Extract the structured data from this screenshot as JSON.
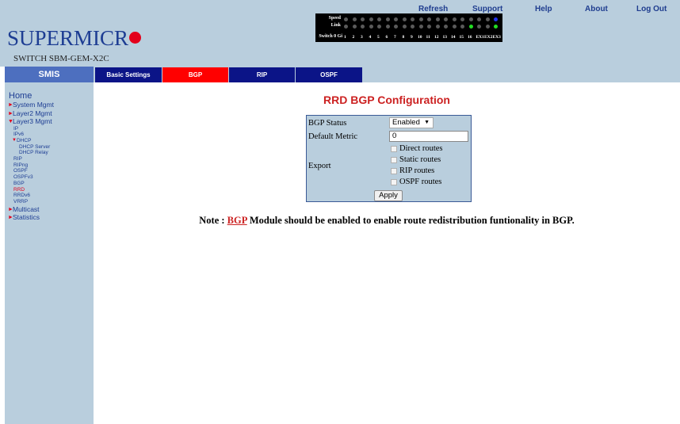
{
  "header": {
    "links": [
      "Refresh",
      "Support",
      "Help",
      "About",
      "Log Out"
    ],
    "logo_text": "SUPERMICR",
    "switch_name": "SWITCH SBM-GEM-X2C"
  },
  "port_panel": {
    "row_labels": [
      "Speed",
      "Link",
      "Switch 0 Gi"
    ],
    "port_numbers": [
      "1",
      "2",
      "3",
      "4",
      "5",
      "6",
      "7",
      "8",
      "9",
      "10",
      "11",
      "12",
      "13",
      "14",
      "15",
      "16",
      "EX1",
      "EX2",
      "EX3"
    ],
    "speed_leds": [
      "off",
      "off",
      "off",
      "off",
      "off",
      "off",
      "off",
      "off",
      "off",
      "off",
      "off",
      "off",
      "off",
      "off",
      "off",
      "off",
      "off",
      "off",
      "blue"
    ],
    "link_leds": [
      "off",
      "off",
      "off",
      "off",
      "off",
      "off",
      "off",
      "off",
      "off",
      "off",
      "off",
      "off",
      "off",
      "off",
      "off",
      "green",
      "off",
      "off",
      "green"
    ],
    "colors": {
      "off": "#5a5a5a",
      "green": "#22dd22",
      "blue": "#2233ee"
    }
  },
  "sidebar": {
    "tab_label": "SMIS",
    "home": "Home",
    "items": [
      {
        "label": "System Mgmt",
        "level": "top",
        "expanded": false
      },
      {
        "label": "Layer2 Mgmt",
        "level": "top",
        "expanded": false
      },
      {
        "label": "Layer3 Mgmt",
        "level": "top",
        "expanded": true
      },
      {
        "label": "IP",
        "level": "sub"
      },
      {
        "label": "IPv6",
        "level": "sub"
      },
      {
        "label": "DHCP",
        "level": "sub",
        "expanded": true
      },
      {
        "label": "DHCP Server",
        "level": "subsub"
      },
      {
        "label": "DHCP Relay",
        "level": "subsub"
      },
      {
        "label": "RIP",
        "level": "sub"
      },
      {
        "label": "RIPng",
        "level": "sub"
      },
      {
        "label": "OSPF",
        "level": "sub"
      },
      {
        "label": "OSPFv3",
        "level": "sub"
      },
      {
        "label": "BGP",
        "level": "sub"
      },
      {
        "label": "RRD",
        "level": "sub",
        "active": true
      },
      {
        "label": "RRDv6",
        "level": "sub"
      },
      {
        "label": "VRRP",
        "level": "sub"
      },
      {
        "label": "Multicast",
        "level": "top",
        "expanded": false
      },
      {
        "label": "Statistics",
        "level": "top",
        "expanded": false
      }
    ]
  },
  "tabs": [
    {
      "label": "Basic Settings",
      "active": false
    },
    {
      "label": "BGP",
      "active": true
    },
    {
      "label": "RIP",
      "active": false
    },
    {
      "label": "OSPF",
      "active": false
    }
  ],
  "main": {
    "title": "RRD BGP Configuration",
    "form": {
      "bgp_status_label": "BGP Status",
      "bgp_status_value": "Enabled",
      "default_metric_label": "Default Metric",
      "default_metric_value": "0",
      "export_label": "Export",
      "export_options": [
        {
          "label": "Direct routes",
          "checked": false
        },
        {
          "label": "Static routes",
          "checked": false
        },
        {
          "label": "RIP routes",
          "checked": false
        },
        {
          "label": "OSPF routes",
          "checked": false
        }
      ],
      "apply_label": "Apply"
    },
    "note": {
      "prefix": "Note : ",
      "link": "BGP",
      "suffix": " Module should be enabled to enable route redistribution funtionality in BGP."
    }
  },
  "colors": {
    "header_bg": "#b9cedd",
    "brand_blue": "#1d3d93",
    "brand_red": "#e3001b",
    "tab_blue": "#0b1487",
    "tab_active": "#ff0000",
    "title_red": "#cc2222"
  }
}
